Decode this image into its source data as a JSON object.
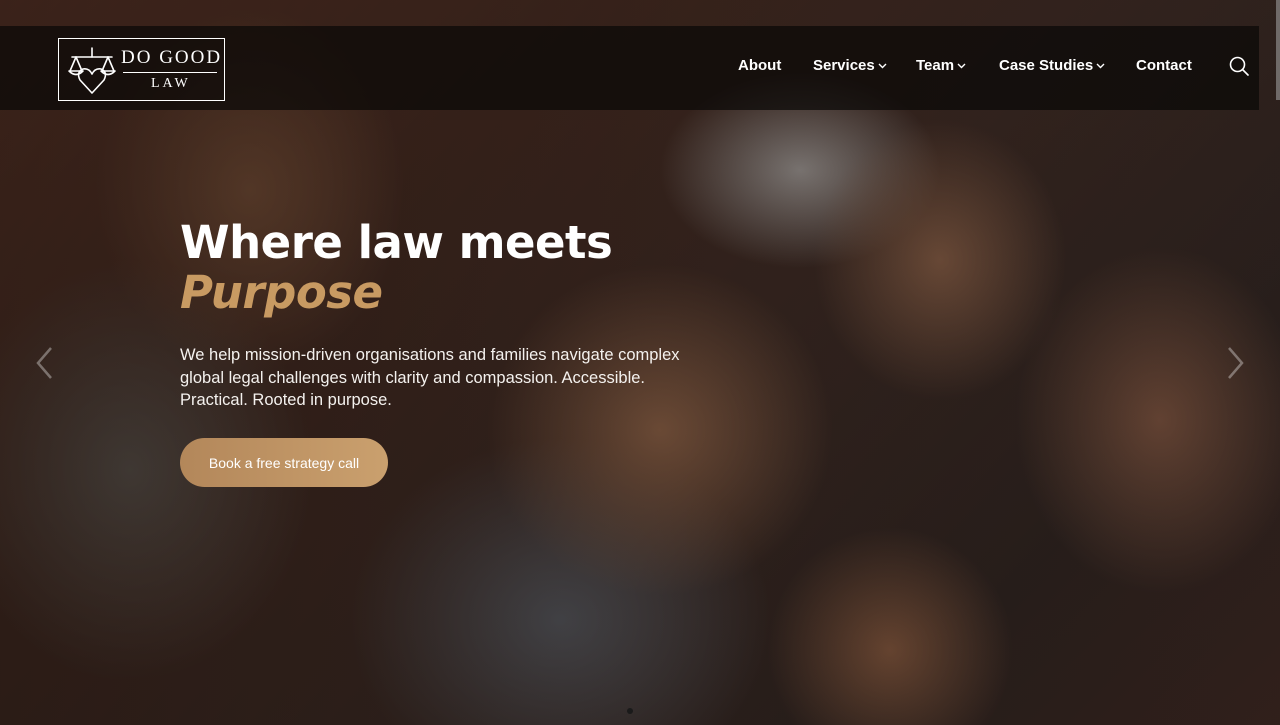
{
  "brand": {
    "line1": "DO GOOD",
    "line2": "LAW"
  },
  "nav": {
    "about": "About",
    "services": "Services",
    "team": "Team",
    "case_studies": "Case Studies",
    "contact": "Contact"
  },
  "hero": {
    "headline": "Where law meets",
    "headline_accent": "Purpose",
    "lead": "We help mission-driven organisations and families navigate complex global legal challenges with clarity and compassion. Accessible. Practical. Rooted in purpose.",
    "cta_label": "Book a free strategy call"
  },
  "slider": {
    "current_slide": 1,
    "slide_count": 1
  },
  "colors": {
    "accent": "#c89a62",
    "header_bg": "#0a0807",
    "text": "#ffffff"
  },
  "icons": {
    "logo": "scales-heart-icon",
    "search": "search-icon",
    "dropdown": "chevron-down-icon",
    "prev": "chevron-left-icon",
    "next": "chevron-right-icon"
  }
}
